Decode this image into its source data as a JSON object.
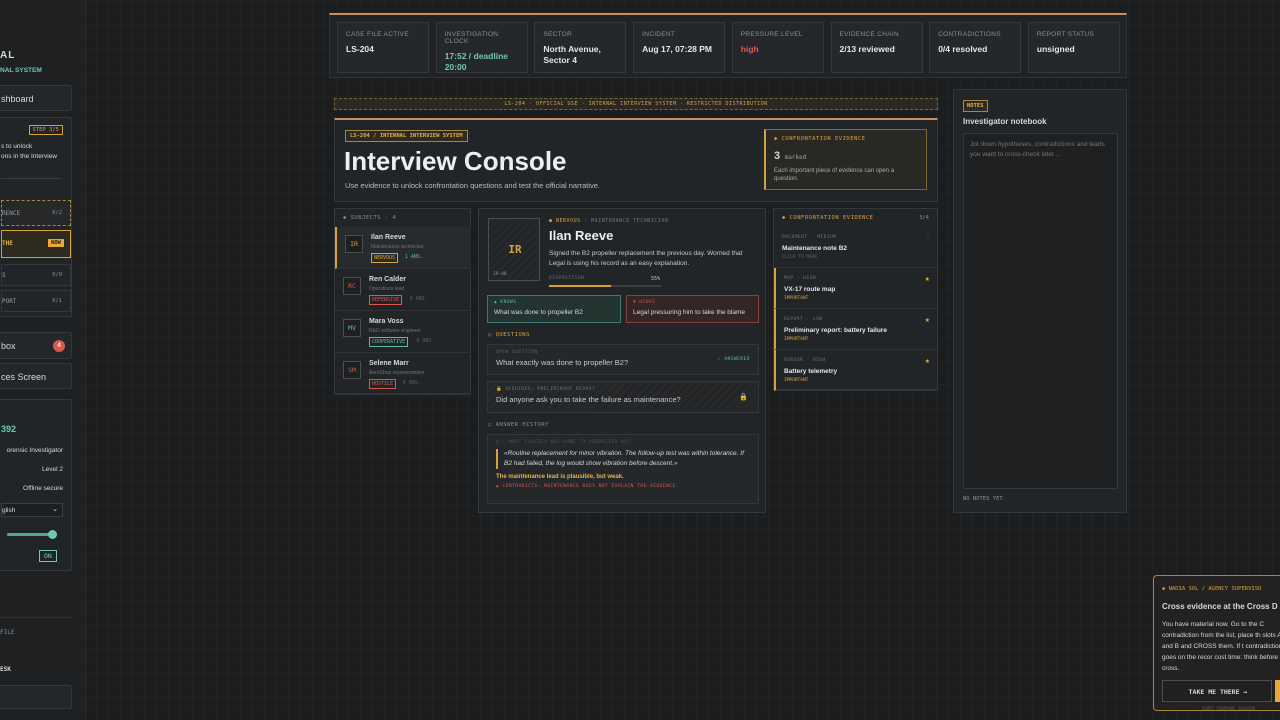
{
  "sidebar": {
    "brand": "AL",
    "brand_sub": "NAL SYSTEM",
    "dashboard": "shboard",
    "step": "STEP 3/5",
    "step_text1": "s to unlock",
    "step_text2": "ons in the Interview",
    "item_evidence": "RENCE",
    "item_evidence_count": "0/2",
    "item_current": "THE",
    "item_current_badge": "NOW",
    "item_s": "S",
    "item_s_count": "0/0",
    "item_report": "PORT",
    "item_report_count": "0/1",
    "inbox": "box",
    "inbox_count": "4",
    "faces": "ces Screen",
    "score": "392",
    "role": "orensic Investigator",
    "level": "Level 2",
    "offline": "Offline secure",
    "lang": "glish",
    "toggle": "ON",
    "file": "FILE",
    "desk": "ESK"
  },
  "header": {
    "stats": [
      {
        "k": "CASE FILE ACTIVE",
        "v": "LS-204",
        "c": "#e4e6e8"
      },
      {
        "k": "INVESTIGATION CLOCK",
        "v": "17:52 / deadline 20:00",
        "c": "#6fc8b4"
      },
      {
        "k": "SECTOR",
        "v": "North Avenue, Sector 4",
        "c": "#e4e6e8"
      },
      {
        "k": "INCIDENT",
        "v": "Aug 17, 07:28 PM",
        "c": "#e4e6e8"
      },
      {
        "k": "PRESSURE LEVEL",
        "v": "high",
        "c": "#e05a4f"
      },
      {
        "k": "EVIDENCE CHAIN",
        "v": "2/13 reviewed",
        "c": "#e4e6e8"
      },
      {
        "k": "CONTRADICTIONS",
        "v": "0/4 resolved",
        "c": "#e4e6e8"
      },
      {
        "k": "REPORT STATUS",
        "v": "unsigned",
        "c": "#e4e6e8"
      }
    ]
  },
  "banner": "LS-204 · OFFICIAL USE · INTERNAL INTERVIEW SYSTEM · RESTRICTED DISTRIBUTION",
  "console": {
    "tag": "LS-204 / INTERNAL INTERVIEW SYSTEM",
    "title": "Interview Console",
    "subtitle": "Use evidence to unlock confrontation questions and test the official narrative.",
    "conf_label": "CONFRONTATION EVIDENCE",
    "conf_count": "3",
    "conf_unit": "marked",
    "conf_desc": "Each important piece of evidence can open a question."
  },
  "subjects": {
    "header": "SUBJECTS · 4",
    "items": [
      {
        "ini": "IR",
        "name": "Ilan Reeve",
        "role": "Maintenance technician",
        "status": "NERVOUS",
        "ans": "1 ANS.",
        "col": "#d9a13e"
      },
      {
        "ini": "RC",
        "name": "Ren Calder",
        "role": "Operations lead",
        "status": "DEFENSIVE",
        "ans": "0 ANS.",
        "col": "#d9584c"
      },
      {
        "ini": "MV",
        "name": "Mara Voss",
        "role": "R&D software engineer",
        "status": "COOPERATIVE",
        "ans": "0 ANS.",
        "col": "#5fb8a5"
      },
      {
        "ini": "SM",
        "name": "Selene Marr",
        "role": "AeroShop representative",
        "status": "HOSTILE",
        "ans": "0 ANS.",
        "col": "#d9584c"
      }
    ]
  },
  "profile": {
    "ini": "IR",
    "code": "IR-08",
    "mood": "NERVOUS",
    "role": "MAINTENANCE TECHNICIAN",
    "name": "Ilan Reeve",
    "desc": "Signed the B2 propeller replacement the previous day. Worried that Legal is using his record as an easy explanation.",
    "disp_label": "DISPOSITION",
    "disp_val": "55%",
    "disposition": 0.55,
    "knows_label": "▲ KNOWS",
    "knows": "What was done to propeller B2",
    "hides_label": "▼ HIDES",
    "hides": "Legal pressuring him to take the blame",
    "questions_label": "QUESTIONS",
    "q1_label": "OPEN QUESTION",
    "q1": "What exactly was done to propeller B2?",
    "q1_status": "✓ ANSWERED",
    "q2_label": "REQUIRES: PRELIMINARY REPORT",
    "q2": "Did anyone ask you to take the failure as maintenance?",
    "history_label": "ANSWER HISTORY",
    "h_q": "Q · WHAT EXACTLY WAS DONE TO PROPELLER B2?",
    "h_a": "«Routine replacement for minor vibration. The follow-up test was within tolerance. If B2 had failed, the log would show vibration before descent.»",
    "h_note": "The maintenance lead is plausible, but weak.",
    "h_contra": "▲ CONTRADICTS: MAINTENANCE DOES NOT EXPLAIN THE SEQUENCE"
  },
  "evidence": {
    "header": "CONFRONTATION EVIDENCE",
    "count": "3/4",
    "items": [
      {
        "meta": "DOCUMENT · MEDIUM",
        "title": "Maintenance note B2",
        "sub": "CLICK TO MARK"
      },
      {
        "meta": "MAP · HIGH",
        "title": "VX-17 route map",
        "sub": "IMPORTANT"
      },
      {
        "meta": "REPORT · LOW",
        "title": "Preliminary report: battery failure",
        "sub": "IMPORTANT"
      },
      {
        "meta": "SENSOR · HIGH",
        "title": "Battery telemetry",
        "sub": "IMPORTANT"
      }
    ]
  },
  "notes": {
    "tag": "NOTES",
    "title": "Investigator notebook",
    "placeholder": "Jot down hypotheses, contradictions and leads you want to cross-check later...",
    "status": "NO NOTES YET"
  },
  "toast": {
    "from": "NADIA SOL / AGENCY SUPERVISO",
    "title": "Cross evidence at the Cross D",
    "body": "You have material now. Go to the C contradiction from the list, place th slots A and B and CROSS them. If t contradiction, it goes on the recor cost time: think before you cross.",
    "btn": "TAKE ME THERE →",
    "foot": "SHORT TERMINAL SESSION"
  }
}
